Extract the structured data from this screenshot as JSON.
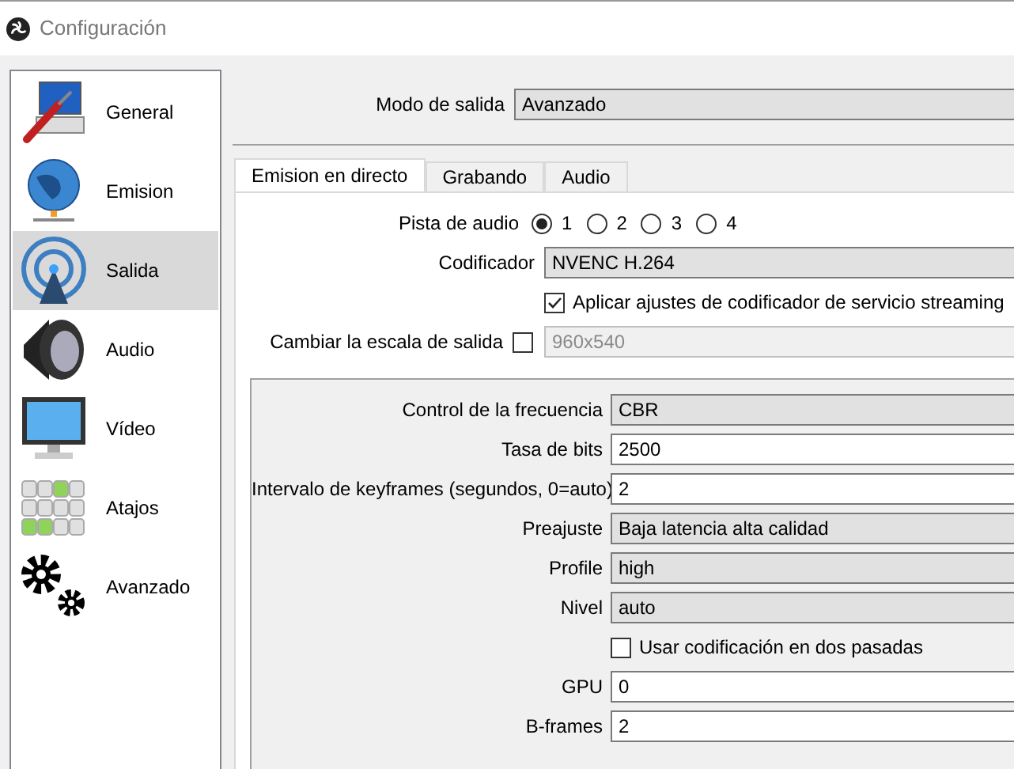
{
  "window": {
    "title": "Configuración"
  },
  "sidebar": {
    "items": [
      {
        "label": "General",
        "selected": false
      },
      {
        "label": "Emision",
        "selected": false
      },
      {
        "label": "Salida",
        "selected": true
      },
      {
        "label": "Audio",
        "selected": false
      },
      {
        "label": "Vídeo",
        "selected": false
      },
      {
        "label": "Atajos",
        "selected": false
      },
      {
        "label": "Avanzado",
        "selected": false
      }
    ]
  },
  "output_mode": {
    "label": "Modo de salida",
    "value": "Avanzado"
  },
  "tabs": [
    {
      "label": "Emision en directo",
      "selected": true
    },
    {
      "label": "Grabando",
      "selected": false
    },
    {
      "label": "Audio",
      "selected": false
    }
  ],
  "audio_track": {
    "label": "Pista de audio",
    "options": [
      {
        "label": "1",
        "selected": true
      },
      {
        "label": "2",
        "selected": false
      },
      {
        "label": "3",
        "selected": false
      },
      {
        "label": "4",
        "selected": false
      }
    ]
  },
  "encoder": {
    "label": "Codificador",
    "value": "NVENC H.264"
  },
  "apply_service_settings": {
    "label": "Aplicar ajustes de codificador de servicio streaming",
    "checked": true
  },
  "rescale": {
    "label": "Cambiar la escala de salida",
    "checked": false,
    "value": "960x540"
  },
  "encoder_settings": [
    {
      "kind": "combo",
      "label": "Control de la frecuencia",
      "value": "CBR"
    },
    {
      "kind": "input",
      "label": "Tasa de bits",
      "value": "2500"
    },
    {
      "kind": "input",
      "label": "Intervalo de keyframes (segundos, 0=auto)",
      "value": "2"
    },
    {
      "kind": "combo",
      "label": "Preajuste",
      "value": "Baja latencia alta calidad"
    },
    {
      "kind": "combo",
      "label": "Profile",
      "value": "high"
    },
    {
      "kind": "combo",
      "label": "Nivel",
      "value": "auto"
    },
    {
      "kind": "checkbox",
      "label": "Usar codificación en dos pasadas",
      "checked": false
    },
    {
      "kind": "input",
      "label": "GPU",
      "value": "0"
    },
    {
      "kind": "input",
      "label": "B-frames",
      "value": "2"
    }
  ]
}
